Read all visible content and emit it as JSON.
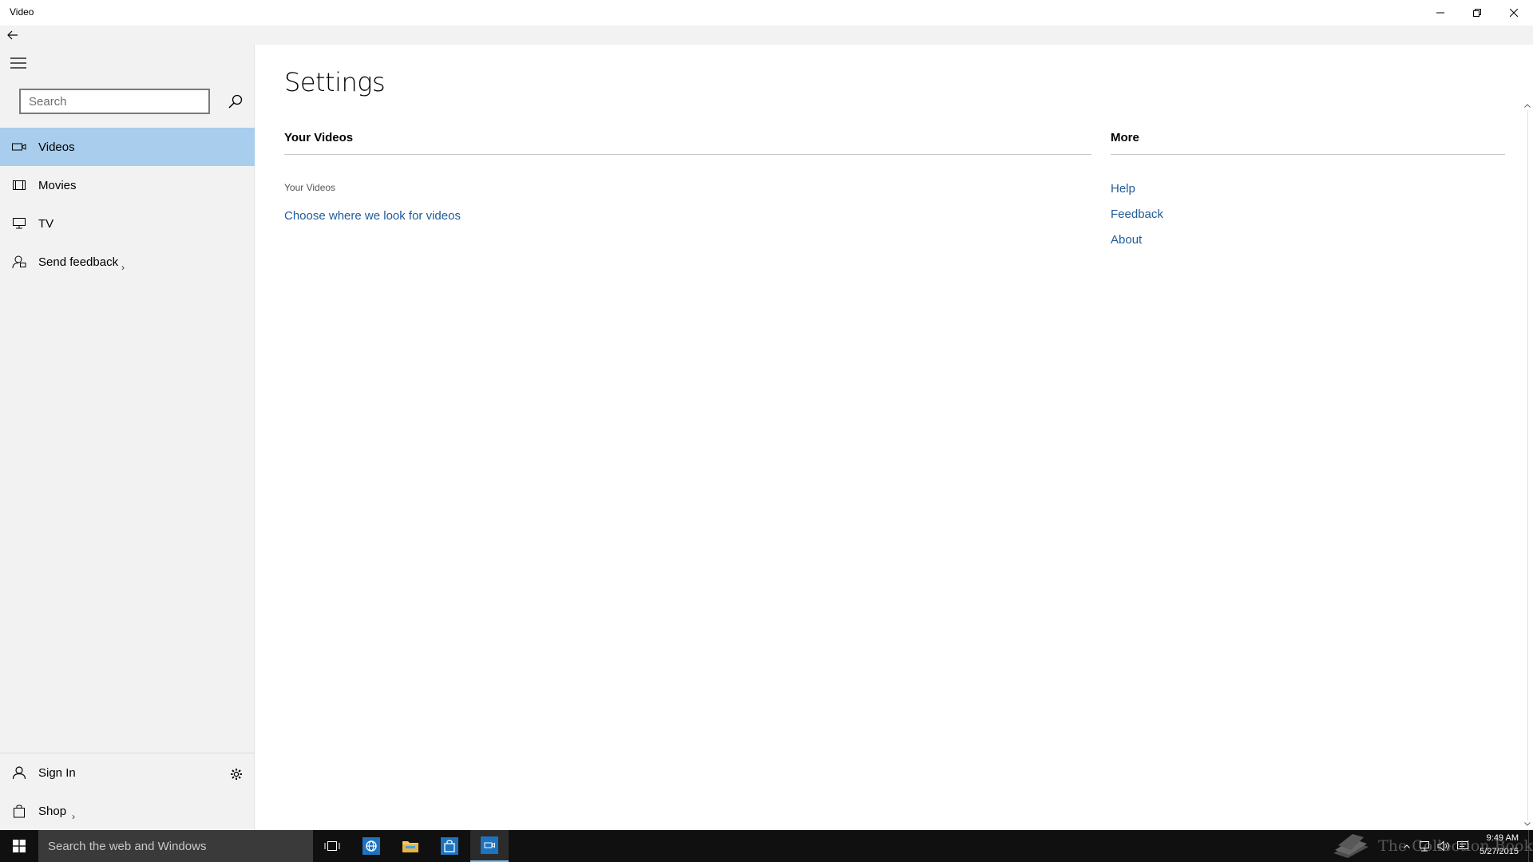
{
  "window": {
    "title": "Video",
    "controls": [
      "minimize-icon",
      "restore-icon",
      "close-icon"
    ]
  },
  "sidebar": {
    "search_placeholder": "Search",
    "items": [
      {
        "label": "Videos",
        "icon": "video-camera-icon",
        "selected": true
      },
      {
        "label": "Movies",
        "icon": "film-icon"
      },
      {
        "label": "TV",
        "icon": "monitor-icon"
      },
      {
        "label": "Send feedback",
        "icon": "feedback-icon"
      }
    ],
    "bottom": [
      {
        "label": "Sign In",
        "icon": "person-icon"
      },
      {
        "label": "Shop",
        "icon": "shopping-bag-icon"
      }
    ]
  },
  "main": {
    "title": "Settings",
    "your_videos": {
      "heading": "Your Videos",
      "sub_label": "Your Videos",
      "link": "Choose where we look for videos"
    },
    "more": {
      "heading": "More",
      "links": [
        "Help",
        "Feedback",
        "About"
      ]
    }
  },
  "taskbar": {
    "search_placeholder": "Search the web and Windows",
    "apps": [
      "task-view-icon",
      "internet-explorer-icon",
      "file-explorer-icon",
      "store-icon",
      "video-app-icon"
    ],
    "clock_time": "9:49 AM",
    "clock_date": "5/27/2015",
    "watermark": "The Collection Book"
  },
  "colors": {
    "accent_selected": "#a9cdec",
    "link": "#1e5b99",
    "sidebar_bg": "#f2f2f2",
    "taskbar_bg": "#101010",
    "taskbar_active": "#76b9ed"
  }
}
